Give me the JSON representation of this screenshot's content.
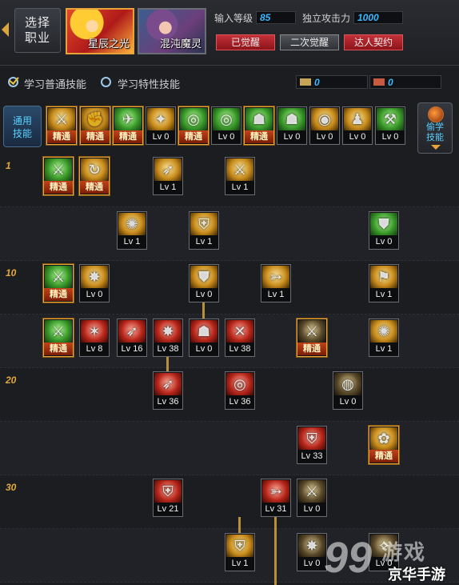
{
  "header": {
    "select_job": "选择\n职业",
    "characters": [
      {
        "name": "星辰之光",
        "active": true
      },
      {
        "name": "混沌魔灵",
        "active": false
      }
    ],
    "input_level_label": "输入等级",
    "input_level_value": "85",
    "independent_attack_label": "独立攻击力",
    "independent_attack_value": "1000",
    "awaken_buttons": [
      "已觉醒",
      "二次觉醒",
      "达人契约"
    ]
  },
  "learn": {
    "normal_skills": "学习普通技能",
    "special_skills": "学习特性技能",
    "sp_points": "0",
    "tp_points": "0"
  },
  "common": {
    "label": "通用\n技能",
    "steal_label": "偷学\n技能",
    "skills": [
      {
        "label": "精通",
        "mastered": true,
        "icon": "ic-gold",
        "glyph": "⚔"
      },
      {
        "label": "精通",
        "mastered": true,
        "icon": "ic-gold",
        "glyph": "✊"
      },
      {
        "label": "精通",
        "mastered": true,
        "icon": "ic-green",
        "glyph": "✈"
      },
      {
        "label": "Lv 0",
        "mastered": false,
        "icon": "ic-gold",
        "glyph": "✦"
      },
      {
        "label": "精通",
        "mastered": true,
        "icon": "ic-green",
        "glyph": "◎"
      },
      {
        "label": "Lv 0",
        "mastered": false,
        "icon": "ic-green",
        "glyph": "◎"
      },
      {
        "label": "精通",
        "mastered": true,
        "icon": "ic-green",
        "glyph": "☗"
      },
      {
        "label": "Lv 0",
        "mastered": false,
        "icon": "ic-green",
        "glyph": "☗"
      },
      {
        "label": "Lv 0",
        "mastered": false,
        "icon": "ic-gold",
        "glyph": "◉"
      },
      {
        "label": "Lv 0",
        "mastered": false,
        "icon": "ic-gold",
        "glyph": "♟"
      },
      {
        "label": "Lv 0",
        "mastered": false,
        "icon": "ic-green",
        "glyph": "⚒"
      }
    ]
  },
  "level_marks": [
    "1",
    "10",
    "20",
    "30"
  ],
  "tree_skills": [
    {
      "label": "精通",
      "mastered": true,
      "icon": "ic-green",
      "glyph": "⚔"
    },
    {
      "label": "精通",
      "mastered": true,
      "icon": "ic-gold",
      "glyph": "↻"
    },
    {
      "label": "Lv 1",
      "mastered": false,
      "icon": "ic-gold",
      "glyph": "➶"
    },
    {
      "label": "Lv 1",
      "mastered": false,
      "icon": "ic-gold",
      "glyph": "⚔"
    },
    {
      "label": "Lv 1",
      "mastered": false,
      "icon": "ic-gold",
      "glyph": "✺"
    },
    {
      "label": "Lv 1",
      "mastered": false,
      "icon": "ic-gold",
      "glyph": "⛨"
    },
    {
      "label": "Lv 0",
      "mastered": false,
      "icon": "ic-green",
      "glyph": "⛊"
    },
    {
      "label": "精通",
      "mastered": true,
      "icon": "ic-green",
      "glyph": "⚔"
    },
    {
      "label": "Lv 0",
      "mastered": false,
      "icon": "ic-gold",
      "glyph": "✸"
    },
    {
      "label": "Lv 0",
      "mastered": false,
      "icon": "ic-gold",
      "glyph": "⛊"
    },
    {
      "label": "Lv 1",
      "mastered": false,
      "icon": "ic-gold",
      "glyph": "➳"
    },
    {
      "label": "Lv 1",
      "mastered": false,
      "icon": "ic-gold",
      "glyph": "⚑"
    },
    {
      "label": "精通",
      "mastered": true,
      "icon": "ic-green",
      "glyph": "⚔"
    },
    {
      "label": "Lv 8",
      "mastered": false,
      "icon": "ic-red",
      "glyph": "✶"
    },
    {
      "label": "Lv 16",
      "mastered": false,
      "icon": "ic-red",
      "glyph": "➶"
    },
    {
      "label": "Lv 38",
      "mastered": false,
      "icon": "ic-red",
      "glyph": "✸"
    },
    {
      "label": "Lv 0",
      "mastered": false,
      "icon": "ic-red",
      "glyph": "☗"
    },
    {
      "label": "Lv 38",
      "mastered": false,
      "icon": "ic-red",
      "glyph": "✕"
    },
    {
      "label": "精通",
      "mastered": true,
      "icon": "ic-dark",
      "glyph": "⚔"
    },
    {
      "label": "Lv 1",
      "mastered": false,
      "icon": "ic-gold",
      "glyph": "✺"
    },
    {
      "label": "Lv 36",
      "mastered": false,
      "icon": "ic-red",
      "glyph": "➶"
    },
    {
      "label": "Lv 36",
      "mastered": false,
      "icon": "ic-red",
      "glyph": "◎"
    },
    {
      "label": "Lv 0",
      "mastered": false,
      "icon": "ic-dark",
      "glyph": "◍"
    },
    {
      "label": "Lv 33",
      "mastered": false,
      "icon": "ic-red",
      "glyph": "⛨"
    },
    {
      "label": "精通",
      "mastered": true,
      "icon": "ic-gold",
      "glyph": "✿"
    },
    {
      "label": "Lv 21",
      "mastered": false,
      "icon": "ic-red",
      "glyph": "⛨"
    },
    {
      "label": "Lv 31",
      "mastered": false,
      "icon": "ic-red",
      "glyph": "➳"
    },
    {
      "label": "Lv 0",
      "mastered": false,
      "icon": "ic-dark",
      "glyph": "⚔"
    },
    {
      "label": "Lv 1",
      "mastered": false,
      "icon": "ic-gold",
      "glyph": "⛨"
    },
    {
      "label": "Lv 0",
      "mastered": false,
      "icon": "ic-dark",
      "glyph": "✸"
    },
    {
      "label": "Lv 0",
      "mastered": false,
      "icon": "ic-dark",
      "glyph": "✧"
    }
  ],
  "watermark": {
    "digits": "99",
    "top": "游戏",
    "bottom": "京华手游"
  }
}
